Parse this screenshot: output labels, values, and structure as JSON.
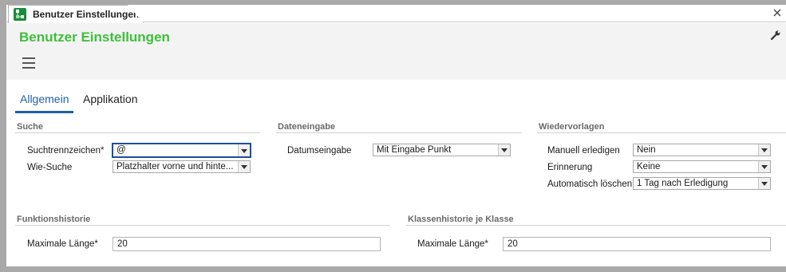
{
  "window": {
    "tab_title": "Benutzer Einstellungen"
  },
  "header": {
    "title": "Benutzer Einstellungen"
  },
  "tabs": [
    {
      "label": "Allgemein",
      "active": true
    },
    {
      "label": "Applikation",
      "active": false
    }
  ],
  "sections": {
    "suche": {
      "title": "Suche",
      "fields": {
        "suchtrennzeichen": {
          "label": "Suchtrennzeichen*",
          "value": "@"
        },
        "wie_suche": {
          "label": "Wie-Suche",
          "value": "Platzhalter vorne und hinte..."
        }
      }
    },
    "dateneingabe": {
      "title": "Dateneingabe",
      "fields": {
        "datumseingabe": {
          "label": "Datumseingabe",
          "value": "Mit Eingabe Punkt"
        }
      }
    },
    "wiedervorlagen": {
      "title": "Wiedervorlagen",
      "fields": {
        "manuell": {
          "label": "Manuell erledigen",
          "value": "Nein"
        },
        "erinnerung": {
          "label": "Erinnerung",
          "value": "Keine"
        },
        "automatisch": {
          "label": "Automatisch löschen",
          "value": "1 Tag nach Erledigung"
        }
      }
    },
    "funktionshistorie": {
      "title": "Funktionshistorie",
      "fields": {
        "max_laenge": {
          "label": "Maximale Länge*",
          "value": "20"
        }
      }
    },
    "klassenhistorie": {
      "title": "Klassenhistorie je Klasse",
      "fields": {
        "max_laenge": {
          "label": "Maximale Länge*",
          "value": "20"
        }
      }
    }
  },
  "colors": {
    "title_green": "#3fbf3a",
    "accent_blue": "#1f5fa8",
    "app_icon_green": "#1b8c3a"
  },
  "icons": [
    "app-icon",
    "close-icon",
    "wrench-icon",
    "hamburger-menu-icon",
    "dropdown-arrow-icon"
  ]
}
